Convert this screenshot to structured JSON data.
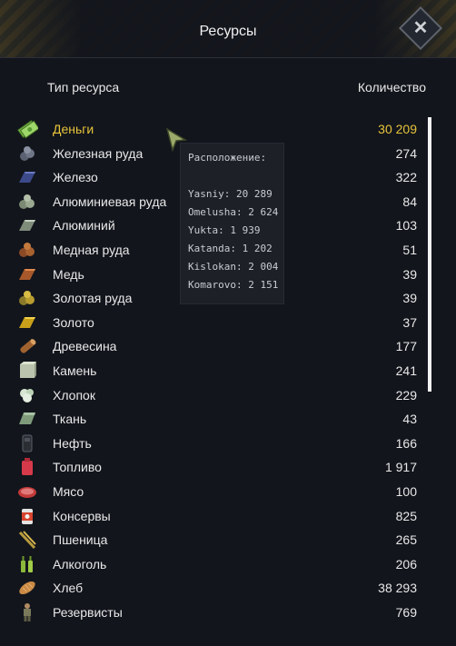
{
  "window": {
    "title": "Ресурсы"
  },
  "header": {
    "type_label": "Тип ресурса",
    "qty_label": "Количество"
  },
  "tooltip": {
    "title": "Расположение:",
    "lines": [
      "Yasniy: 20 289",
      "Omelusha: 2 624",
      "Yukta: 1 939",
      "Katanda: 1 202",
      "Kislokan: 2 004",
      "Komarovo: 2 151"
    ]
  },
  "resources": [
    {
      "name": "Деньги",
      "value": "30 209",
      "icon": "money-icon"
    },
    {
      "name": "Железная руда",
      "value": "274",
      "icon": "iron-ore-icon"
    },
    {
      "name": "Железо",
      "value": "322",
      "icon": "iron-icon"
    },
    {
      "name": "Алюминиевая руда",
      "value": "84",
      "icon": "aluminium-ore-icon"
    },
    {
      "name": "Алюминий",
      "value": "103",
      "icon": "aluminium-icon"
    },
    {
      "name": "Медная руда",
      "value": "51",
      "icon": "copper-ore-icon"
    },
    {
      "name": "Медь",
      "value": "39",
      "icon": "copper-icon"
    },
    {
      "name": "Золотая руда",
      "value": "39",
      "icon": "gold-ore-icon"
    },
    {
      "name": "Золото",
      "value": "37",
      "icon": "gold-icon"
    },
    {
      "name": "Древесина",
      "value": "177",
      "icon": "wood-icon"
    },
    {
      "name": "Камень",
      "value": "241",
      "icon": "stone-icon"
    },
    {
      "name": "Хлопок",
      "value": "229",
      "icon": "cotton-icon"
    },
    {
      "name": "Ткань",
      "value": "43",
      "icon": "fabric-icon"
    },
    {
      "name": "Нефть",
      "value": "166",
      "icon": "oil-icon"
    },
    {
      "name": "Топливо",
      "value": "1 917",
      "icon": "fuel-icon"
    },
    {
      "name": "Мясо",
      "value": "100",
      "icon": "meat-icon"
    },
    {
      "name": "Консервы",
      "value": "825",
      "icon": "canned-food-icon"
    },
    {
      "name": "Пшеница",
      "value": "265",
      "icon": "wheat-icon"
    },
    {
      "name": "Алкоголь",
      "value": "206",
      "icon": "alcohol-icon"
    },
    {
      "name": "Хлеб",
      "value": "38 293",
      "icon": "bread-icon"
    },
    {
      "name": "Резервисты",
      "value": "769",
      "icon": "reservists-icon"
    }
  ],
  "colors": {
    "money": "#e7c43a",
    "text": "#e8e8e8",
    "background": "#12151c"
  }
}
